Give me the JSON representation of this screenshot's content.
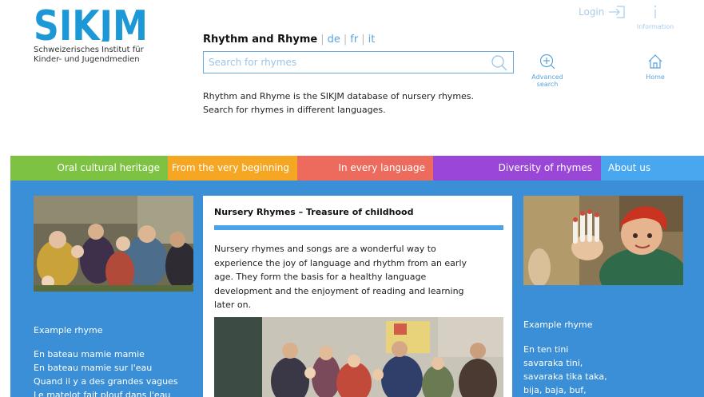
{
  "brand": {
    "logo_text": "SIKJM",
    "subtitle_line1": "Schweizerisches Institut für",
    "subtitle_line2": "Kinder- und Jugendmedien",
    "color": "#1c98d6"
  },
  "header": {
    "title": "Rhythm and Rhyme",
    "languages": [
      "de",
      "fr",
      "it"
    ],
    "search_placeholder": "Search for rhymes",
    "intro_line1": "Rhythm and Rhyme is the SIKJM database of nursery rhymes.",
    "intro_line2": "Search for rhymes in different languages."
  },
  "tools": {
    "login_label": "Login",
    "information_label": "Information",
    "advanced_line1": "Advanced",
    "advanced_line2": "search",
    "home_label": "Home"
  },
  "nav": [
    {
      "label": "Oral cultural heritage",
      "color": "#7dc242"
    },
    {
      "label": "From the very beginning",
      "color": "#f5a623"
    },
    {
      "label": "In every language",
      "color": "#ec6b5c"
    },
    {
      "label": "Diversity of rhymes",
      "color": "#9a47d8"
    },
    {
      "label": "About us",
      "color": "#49a7ef"
    }
  ],
  "left": {
    "heading": "Example rhyme",
    "lines": [
      "En bateau mamie mamie",
      "En bateau mamie sur l'eau",
      "Quand il y a des grandes vagues",
      "Le matelot fait plouf dans l'eau"
    ]
  },
  "card": {
    "title": "Nursery Rhymes – Treasure of childhood",
    "lines": [
      "Nursery rhymes and songs are a wonderful way to",
      "experience the joy of language and rhythm from an early",
      "age. They form the basis for a healthy language",
      "development and the enjoyment of reading and learning",
      "later on."
    ]
  },
  "right": {
    "heading": "Example rhyme",
    "lines": [
      "En ten tini",
      "savaraka tini,",
      "savaraka tika taka,",
      "bija, baja, buf,"
    ]
  },
  "colors": {
    "main_bg": "#3a8fd6",
    "accent": "#4aa3e8",
    "link": "#5aa4de"
  }
}
